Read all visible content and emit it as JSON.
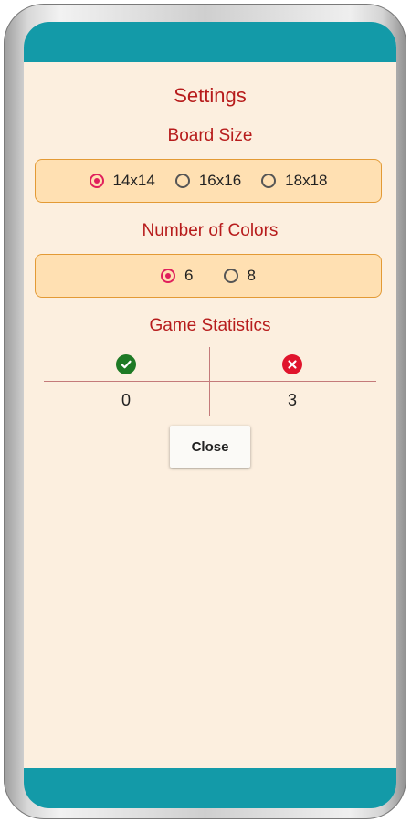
{
  "dialog": {
    "title": "Settings",
    "board_size": {
      "label": "Board Size",
      "options": [
        "14x14",
        "16x16",
        "18x18"
      ],
      "selected": "14x14"
    },
    "colors": {
      "label": "Number of Colors",
      "options": [
        "6",
        "8"
      ],
      "selected": "6"
    },
    "statistics": {
      "label": "Game Statistics",
      "wins_icon": "check-circle-icon",
      "losses_icon": "x-circle-icon",
      "wins": "0",
      "losses": "3"
    },
    "close_label": "Close"
  },
  "colors_theme": {
    "bar": "#139aa8",
    "background": "#fcefdf",
    "heading": "#b71c1c",
    "box_fill": "#ffe0b2",
    "box_border": "#e39a35",
    "radio_accent": "#e01f5c",
    "win": "#1e7a25",
    "loss": "#e0142c"
  }
}
